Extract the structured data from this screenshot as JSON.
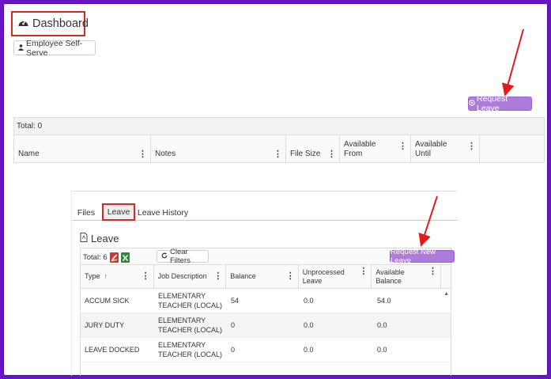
{
  "dashboard": {
    "title": "Dashboard"
  },
  "top": {
    "employee_self_serve": "Employee Self-Serve",
    "request_leave": "Request Leave",
    "total": "Total: 0",
    "columns": [
      {
        "label": "Name"
      },
      {
        "label": "Notes"
      },
      {
        "label": "File Size"
      },
      {
        "label": "Available From"
      },
      {
        "label": "Available Until"
      }
    ]
  },
  "panel": {
    "tabs": [
      "Files",
      "Leave",
      "Leave History"
    ],
    "section_title": "Leave",
    "total": "Total: 6",
    "clear_filters": "Clear Filters",
    "request_new_leave": "Request New Leave",
    "columns": [
      "Type",
      "Job Description",
      "Balance",
      "Unprocessed Leave",
      "Available Balance"
    ],
    "rows": [
      {
        "type": "ACCUM SICK",
        "job": "ELEMENTARY TEACHER (LOCAL)",
        "balance": "54",
        "unprocessed": "0.0",
        "available": "54.0"
      },
      {
        "type": "JURY DUTY",
        "job": "ELEMENTARY TEACHER (LOCAL)",
        "balance": "0",
        "unprocessed": "0.0",
        "available": "0.0"
      },
      {
        "type": "LEAVE DOCKED",
        "job": "ELEMENTARY TEACHER (LOCAL)",
        "balance": "0",
        "unprocessed": "0.0",
        "available": "0.0"
      }
    ]
  },
  "colors": {
    "accent_purple": "#ad7cdb",
    "highlight_red": "#d62828",
    "frame_purple": "#6a14c8"
  }
}
